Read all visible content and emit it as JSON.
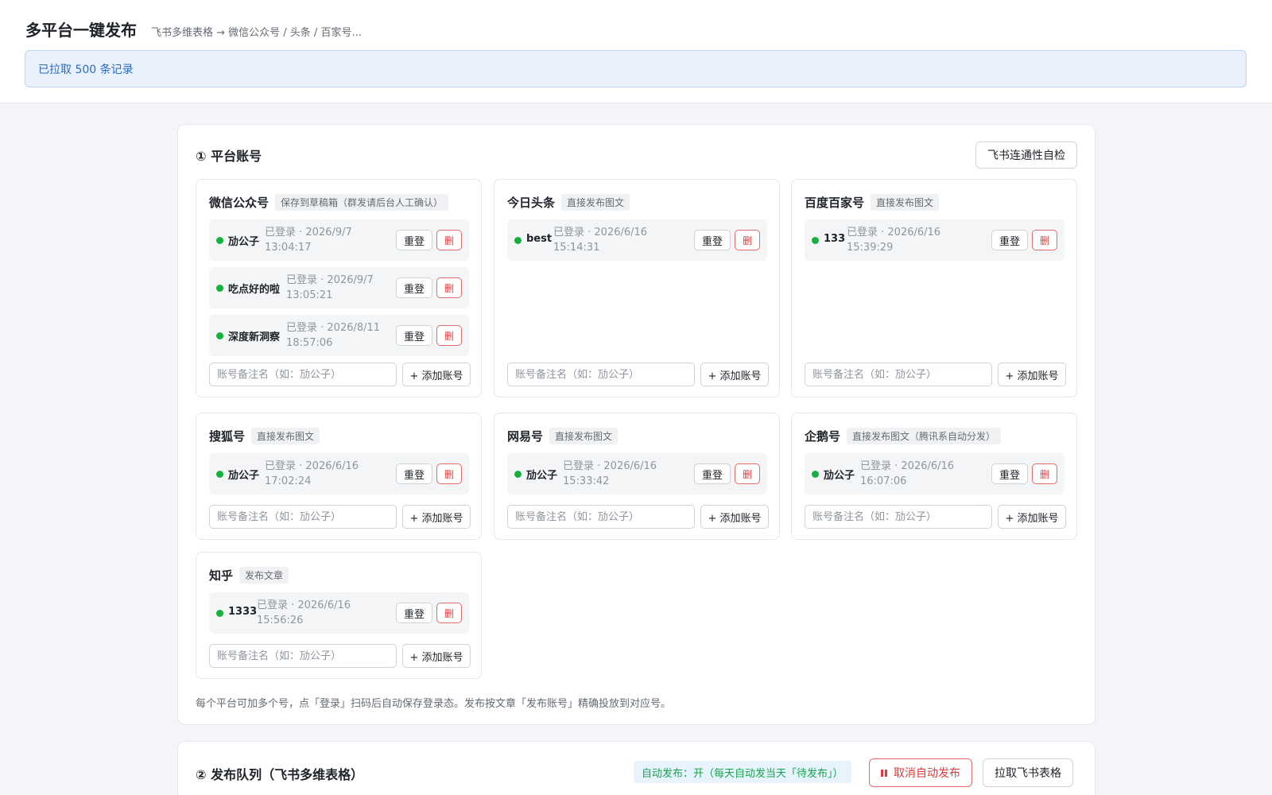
{
  "header": {
    "title": "多平台一键发布",
    "subtitle": "飞书多维表格 → 微信公众号 / 头条 / 百家号...",
    "banner": "已拉取 500 条记录"
  },
  "accounts_section": {
    "title": "① 平台账号",
    "check_button": "飞书连通性自检",
    "relogin_label": "重登",
    "delete_label": "删",
    "add_placeholder": "账号备注名（如：劢公子）",
    "add_label": "+ 添加账号",
    "hint": "每个平台可加多个号，点「登录」扫码后自动保存登录态。发布按文章「发布账号」精确投放到对应号。",
    "platforms": [
      {
        "name": "微信公众号",
        "tag": "保存到草稿箱（群发请后台人工确认）",
        "accounts": [
          {
            "name": "劢公子",
            "status": "已登录 · 2026/9/7",
            "time": "13:04:17"
          },
          {
            "name": "吃点好的啦",
            "status": "已登录 · 2026/9/7",
            "time": "13:05:21"
          },
          {
            "name": "深度新洞察",
            "status": "已登录 · 2026/8/11",
            "time": "18:57:06"
          }
        ]
      },
      {
        "name": "今日头条",
        "tag": "直接发布图文",
        "accounts": [
          {
            "name": "best",
            "status": "已登录 · 2026/6/16",
            "time": "15:14:31"
          }
        ]
      },
      {
        "name": "百度百家号",
        "tag": "直接发布图文",
        "accounts": [
          {
            "name": "133",
            "status": "已登录 · 2026/6/16",
            "time": "15:39:29"
          }
        ]
      },
      {
        "name": "搜狐号",
        "tag": "直接发布图文",
        "accounts": [
          {
            "name": "劢公子",
            "status": "已登录 · 2026/6/16",
            "time": "17:02:24"
          }
        ]
      },
      {
        "name": "网易号",
        "tag": "直接发布图文",
        "accounts": [
          {
            "name": "劢公子",
            "status": "已登录 · 2026/6/16",
            "time": "15:33:42"
          }
        ]
      },
      {
        "name": "企鹅号",
        "tag": "直接发布图文（腾讯系自动分发）",
        "accounts": [
          {
            "name": "劢公子",
            "status": "已登录 · 2026/6/16",
            "time": "16:07:06"
          }
        ]
      },
      {
        "name": "知乎",
        "tag": "发布文章",
        "accounts": [
          {
            "name": "1333",
            "status": "已登录 · 2026/6/16",
            "time": "15:56:26"
          }
        ]
      }
    ]
  },
  "queue_section": {
    "title": "② 发布队列（飞书多维表格）",
    "auto_status": "自动发布：开（每天自动发当天「待发布」）",
    "cancel_button": "取消自动发布",
    "pull_button": "拉取飞书表格"
  },
  "colors": {
    "accent_blue": "#2c6cc5",
    "online_green": "#12b23c",
    "danger_red": "#e03b3b"
  }
}
